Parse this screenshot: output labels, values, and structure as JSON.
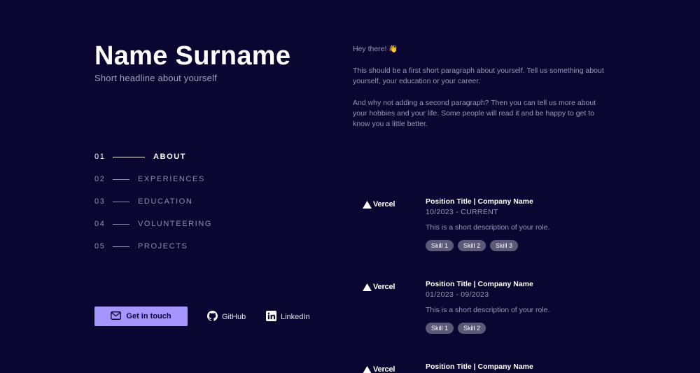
{
  "header": {
    "name": "Name Surname",
    "headline": "Short headline about yourself"
  },
  "nav": [
    {
      "num": "01",
      "label": "ABOUT",
      "active": true
    },
    {
      "num": "02",
      "label": "EXPERIENCES",
      "active": false
    },
    {
      "num": "03",
      "label": "EDUCATION",
      "active": false
    },
    {
      "num": "04",
      "label": "VOLUNTEERING",
      "active": false
    },
    {
      "num": "05",
      "label": "PROJECTS",
      "active": false
    }
  ],
  "cta": {
    "label": "Get in touch",
    "icon": "mail-icon"
  },
  "socials": [
    {
      "label": "GitHub",
      "icon": "github-icon"
    },
    {
      "label": "LinkedIn",
      "icon": "linkedin-icon"
    }
  ],
  "about": {
    "greeting": "Hey there! 👋",
    "paragraph1": "This should be a first short paragraph about yourself. Tell us something about yourself, your education or your career.",
    "paragraph2": "And why not adding a second paragraph? Then you can tell us more about your hobbies and your life. Some people will read it and be happy to get to know you a little better."
  },
  "experiences": [
    {
      "logo": "Vercel",
      "title": "Position Title | Company Name",
      "date": "10/2023 - CURRENT",
      "description": "This is a short description of your role.",
      "skills": [
        "Skill 1",
        "Skill 2",
        "Skill 3"
      ]
    },
    {
      "logo": "Vercel",
      "title": "Position Title | Company Name",
      "date": "01/2023 - 09/2023",
      "description": "This is a short description of your role.",
      "skills": [
        "Skill 1",
        "Skill 2"
      ]
    },
    {
      "logo": "Vercel",
      "title": "Position Title | Company Name",
      "date": "",
      "description": "",
      "skills": []
    }
  ],
  "colors": {
    "background": "#0b0631",
    "accent": "#a795ff",
    "skill_pill": "#5c5a76"
  }
}
